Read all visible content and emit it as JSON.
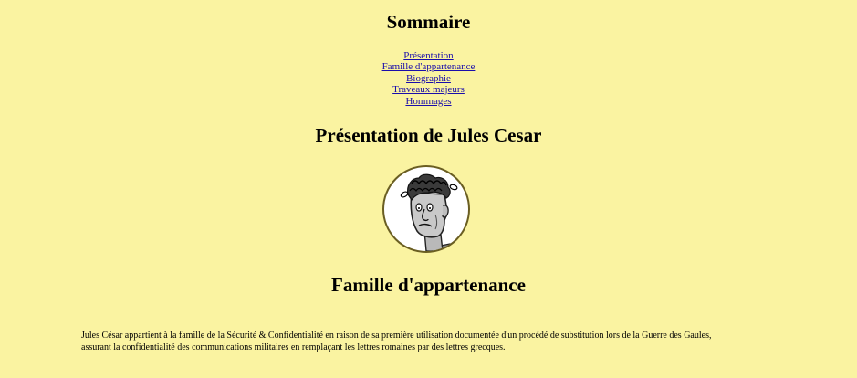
{
  "summary": {
    "title": "Sommaire",
    "links": [
      "Présentation",
      "Famille d'appartenance",
      "Biographie",
      "Traveaux majeurs",
      "Hommages"
    ]
  },
  "presentation": {
    "title": "Présentation de Jules Cesar"
  },
  "family": {
    "title": "Famille d'appartenance",
    "paragraph_line1": "Jules César appartient à la famille de la Sécurité & Confidentialité en raison de sa première utilisation documentée d'un procédé de substitution lors de la Guerre des Gaules,",
    "paragraph_line2": "assurant la confidentialité des communications militaires en remplaçant les lettres romaines par des lettres grecques."
  },
  "colors": {
    "background": "#faf3a1",
    "link": "#1a0dab",
    "portrait_border": "#6a5e22"
  }
}
